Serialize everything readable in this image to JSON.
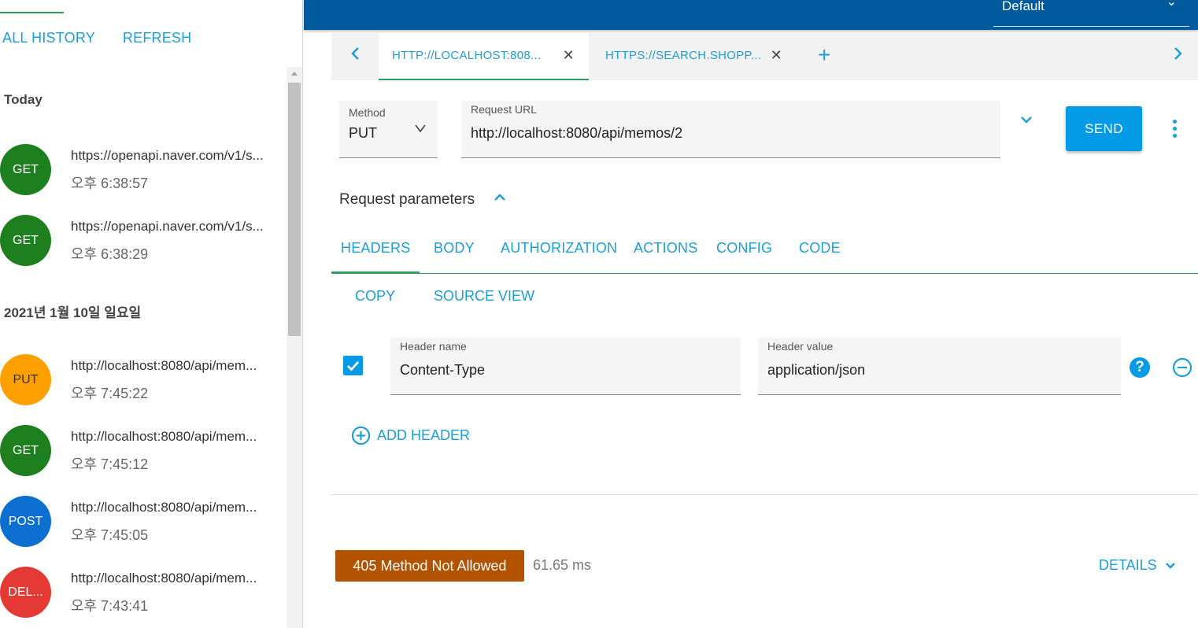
{
  "history": {
    "all_history": "ALL HISTORY",
    "refresh": "REFRESH",
    "groups": [
      {
        "title": "Today"
      },
      {
        "title": "2021년 1월 10일 일요일"
      }
    ],
    "items": [
      {
        "method": "GET",
        "color": "#1e7f1e",
        "url": "https://openapi.naver.com/v1/s...",
        "time": "오후 6:38:57"
      },
      {
        "method": "GET",
        "color": "#1e7f1e",
        "url": "https://openapi.naver.com/v1/s...",
        "time": "오후 6:38:29"
      },
      {
        "method": "PUT",
        "color": "#ffa000",
        "url": "http://localhost:8080/api/mem...",
        "time": "오후 7:45:22"
      },
      {
        "method": "GET",
        "color": "#1e7f1e",
        "url": "http://localhost:8080/api/mem...",
        "time": "오후 7:45:12"
      },
      {
        "method": "POST",
        "color": "#0d6fd0",
        "url": "http://localhost:8080/api/mem...",
        "time": "오후 7:45:05"
      },
      {
        "method": "DEL...",
        "color": "#e53935",
        "url": "http://localhost:8080/api/mem...",
        "time": "오후 7:43:41"
      }
    ]
  },
  "topbar": {
    "environment": "Default"
  },
  "tabs": [
    {
      "label": "HTTP://LOCALHOST:808...",
      "active": true
    },
    {
      "label": "HTTPS://SEARCH.SHOPP...",
      "active": false
    }
  ],
  "request": {
    "method_label": "Method",
    "method_value": "PUT",
    "url_label": "Request URL",
    "url_value": "http://localhost:8080/api/memos/2",
    "send_label": "SEND",
    "params_title": "Request parameters"
  },
  "editor_tabs": [
    "HEADERS",
    "BODY",
    "AUTHORIZATION",
    "ACTIONS",
    "CONFIG",
    "CODE"
  ],
  "header_actions": {
    "copy": "COPY",
    "source_view": "SOURCE VIEW"
  },
  "header_row": {
    "name_label": "Header name",
    "name_value": "Content-Type",
    "value_label": "Header value",
    "value_value": "application/json",
    "enabled": true
  },
  "add_header_label": "ADD HEADER",
  "response": {
    "status": "405 Method Not Allowed",
    "status_color": "#b35200",
    "timing": "61.65 ms",
    "details_label": "DETAILS"
  },
  "colors": {
    "accent": "#1a9fd8",
    "topbar": "#005a9c",
    "tab_underline": "#2e9e5e"
  }
}
